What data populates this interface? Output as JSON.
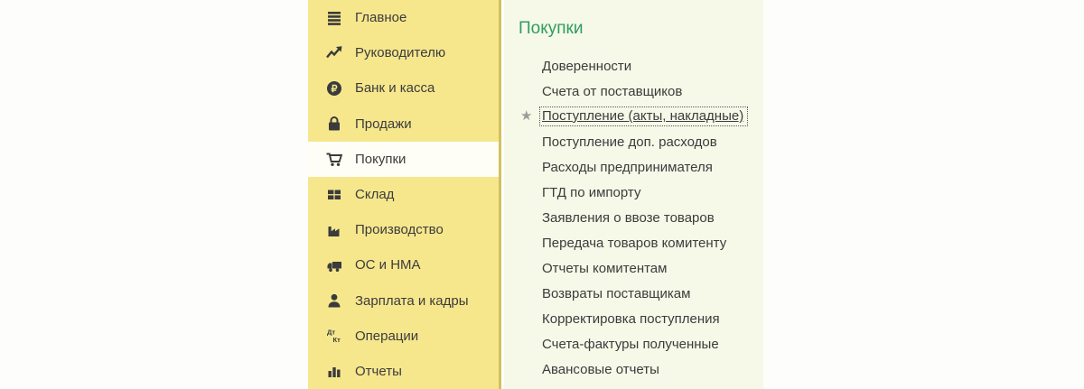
{
  "colors": {
    "page_bg": "#fdfefb",
    "sidebar_bg": "#f6e78d",
    "sidebar_border": "#d2c15c",
    "selected_bg": "#fffef6",
    "panel_bg": "#f6f8e8",
    "title_color": "#2e9e60",
    "text_color": "#3c3c3c",
    "icon_color": "#3b3b3b",
    "star_color": "#9c9c9c",
    "focus_border": "#5a5a5a"
  },
  "sidebar": {
    "items": [
      {
        "label": "Главное",
        "icon": "hamburger-icon",
        "selected": false
      },
      {
        "label": "Руководителю",
        "icon": "trending-up-icon",
        "selected": false
      },
      {
        "label": "Банк и касса",
        "icon": "ruble-circle-icon",
        "selected": false
      },
      {
        "label": "Продажи",
        "icon": "shopping-bag-icon",
        "selected": false
      },
      {
        "label": "Покупки",
        "icon": "shopping-cart-icon",
        "selected": true
      },
      {
        "label": "Склад",
        "icon": "pallet-grid-icon",
        "selected": false
      },
      {
        "label": "Производство",
        "icon": "factory-icon",
        "selected": false
      },
      {
        "label": "ОС и НМА",
        "icon": "truck-icon",
        "selected": false
      },
      {
        "label": "Зарплата и кадры",
        "icon": "person-icon",
        "selected": false
      },
      {
        "label": "Операции",
        "icon": "debit-credit-icon",
        "selected": false
      },
      {
        "label": "Отчеты",
        "icon": "bar-chart-icon",
        "selected": false
      }
    ]
  },
  "panel": {
    "title": "Покупки",
    "star_glyph": "★",
    "items": [
      {
        "label": "Доверенности",
        "starred": false,
        "focused": false
      },
      {
        "label": "Счета от поставщиков",
        "starred": false,
        "focused": false
      },
      {
        "label": "Поступление (акты, накладные)",
        "starred": true,
        "focused": true
      },
      {
        "label": "Поступление доп. расходов",
        "starred": false,
        "focused": false
      },
      {
        "label": "Расходы предпринимателя",
        "starred": false,
        "focused": false
      },
      {
        "label": "ГТД по импорту",
        "starred": false,
        "focused": false
      },
      {
        "label": "Заявления о ввозе товаров",
        "starred": false,
        "focused": false
      },
      {
        "label": "Передача товаров комитенту",
        "starred": false,
        "focused": false
      },
      {
        "label": "Отчеты комитентам",
        "starred": false,
        "focused": false
      },
      {
        "label": "Возвраты поставщикам",
        "starred": false,
        "focused": false
      },
      {
        "label": "Корректировка поступления",
        "starred": false,
        "focused": false
      },
      {
        "label": "Счета-фактуры полученные",
        "starred": false,
        "focused": false
      },
      {
        "label": "Авансовые отчеты",
        "starred": false,
        "focused": false
      }
    ]
  }
}
